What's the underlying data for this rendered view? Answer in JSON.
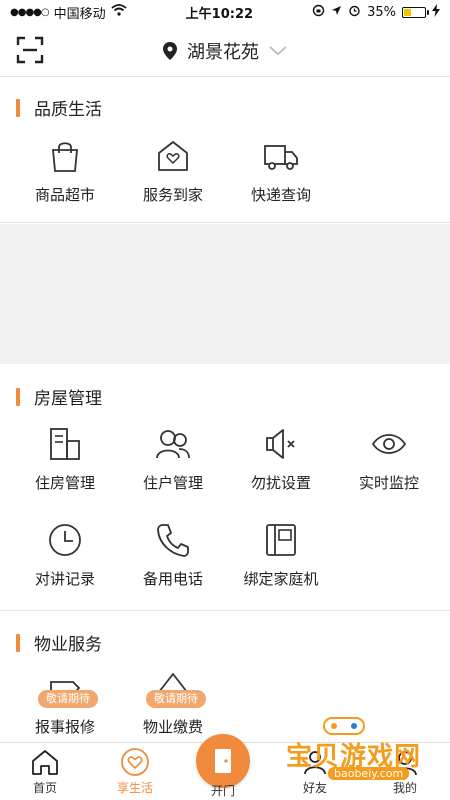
{
  "status_bar": {
    "carrier": "中国移动",
    "time": "上午10:22",
    "battery_percent": "35%",
    "battery_level": 0.35
  },
  "header": {
    "location": "湖景花苑"
  },
  "sections": {
    "quality_life": {
      "title": "品质生活",
      "items": [
        {
          "label": "商品超市",
          "icon": "shopping-bag-icon"
        },
        {
          "label": "服务到家",
          "icon": "home-heart-icon"
        },
        {
          "label": "快递查询",
          "icon": "delivery-truck-icon"
        }
      ]
    },
    "house_management": {
      "title": "房屋管理",
      "items": [
        {
          "label": "住房管理",
          "icon": "building-icon"
        },
        {
          "label": "住户管理",
          "icon": "residents-icon"
        },
        {
          "label": "勿扰设置",
          "icon": "mute-speaker-icon"
        },
        {
          "label": "实时监控",
          "icon": "eye-icon"
        },
        {
          "label": "对讲记录",
          "icon": "clock-icon"
        },
        {
          "label": "备用电话",
          "icon": "phone-icon"
        },
        {
          "label": "绑定家庭机",
          "icon": "home-device-icon"
        }
      ]
    },
    "property_service": {
      "title": "物业服务",
      "items": [
        {
          "label": "报事报修",
          "icon": "repair-icon",
          "badge": "敬请期待"
        },
        {
          "label": "物业缴费",
          "icon": "payment-icon",
          "badge": "敬请期待"
        }
      ]
    }
  },
  "tabbar": {
    "tabs": [
      {
        "label": "首页",
        "icon": "home-icon"
      },
      {
        "label": "享生活",
        "icon": "heart-circle-icon"
      },
      {
        "label": "开门",
        "icon": "door-icon"
      },
      {
        "label": "好友",
        "icon": "friends-icon"
      },
      {
        "label": "我的",
        "icon": "profile-icon"
      }
    ]
  },
  "watermark": {
    "text": "宝贝游戏网",
    "url": "baobeiy.com"
  },
  "colors": {
    "accent": "#f08a3c",
    "badge": "#f2a86c",
    "watermark": "#f39c1e"
  }
}
